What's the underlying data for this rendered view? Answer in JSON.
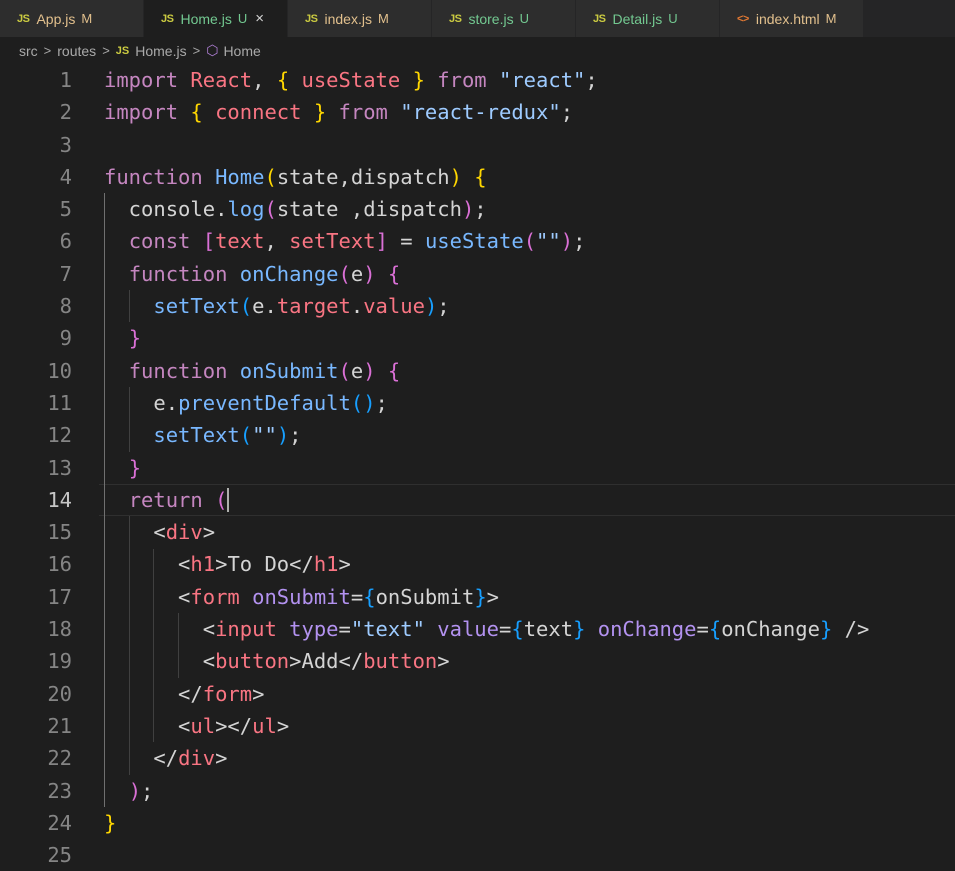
{
  "tabs": [
    {
      "icon": "JS",
      "name": "App.js",
      "status": "M",
      "name_color": "#e2c08d",
      "status_color": "#e2c08d",
      "icon_color": "#cbcb41",
      "active": false
    },
    {
      "icon": "JS",
      "name": "Home.js",
      "status": "U",
      "name_color": "#73c991",
      "status_color": "#73c991",
      "icon_color": "#cbcb41",
      "active": true,
      "close": "×"
    },
    {
      "icon": "JS",
      "name": "index.js",
      "status": "M",
      "name_color": "#e2c08d",
      "status_color": "#e2c08d",
      "icon_color": "#cbcb41",
      "active": false
    },
    {
      "icon": "JS",
      "name": "store.js",
      "status": "U",
      "name_color": "#73c991",
      "status_color": "#73c991",
      "icon_color": "#cbcb41",
      "active": false
    },
    {
      "icon": "JS",
      "name": "Detail.js",
      "status": "U",
      "name_color": "#73c991",
      "status_color": "#73c991",
      "icon_color": "#cbcb41",
      "active": false
    },
    {
      "icon": "<>",
      "name": "index.html",
      "status": "M",
      "name_color": "#e2c08d",
      "status_color": "#e2c08d",
      "icon_color": "#e37933",
      "active": false
    }
  ],
  "breadcrumb": {
    "folder1": "src",
    "folder2": "routes",
    "file_icon": "JS",
    "file": "Home.js",
    "symbol": "Home"
  },
  "current_line": 14,
  "colors": {
    "keyword": "#c586c0",
    "storage": "#569cd6",
    "function": "#dcdcaa",
    "variable": "#9cdcfe",
    "string": "#ce9178",
    "tag": "#569cd6",
    "attr": "#9cdcfe",
    "text": "#d4d4d4",
    "bracket1": "#ffd700",
    "bracket2": "#da70d6",
    "bracket3": "#179fff"
  },
  "lines": [
    {
      "n": "1",
      "t": [
        [
          "import ",
          "#c586c0"
        ],
        [
          "React",
          "#f97583"
        ],
        [
          ", ",
          "#d4d4d4"
        ],
        [
          "{",
          "#ffd700"
        ],
        [
          " ",
          "#d4d4d4"
        ],
        [
          "useState",
          "#f97583"
        ],
        [
          " ",
          "#d4d4d4"
        ],
        [
          "}",
          "#ffd700"
        ],
        [
          " ",
          "#d4d4d4"
        ],
        [
          "from",
          "#c586c0"
        ],
        [
          " ",
          "#d4d4d4"
        ],
        [
          "\"react\"",
          "#9ecbff"
        ],
        [
          ";",
          "#d4d4d4"
        ]
      ]
    },
    {
      "n": "2",
      "t": [
        [
          "import ",
          "#c586c0"
        ],
        [
          "{",
          "#ffd700"
        ],
        [
          " ",
          "#d4d4d4"
        ],
        [
          "connect",
          "#f97583"
        ],
        [
          " ",
          "#d4d4d4"
        ],
        [
          "}",
          "#ffd700"
        ],
        [
          " ",
          "#d4d4d4"
        ],
        [
          "from",
          "#c586c0"
        ],
        [
          " ",
          "#d4d4d4"
        ],
        [
          "\"react-redux\"",
          "#9ecbff"
        ],
        [
          ";",
          "#d4d4d4"
        ]
      ]
    },
    {
      "n": "3",
      "t": []
    },
    {
      "n": "4",
      "t": [
        [
          "function ",
          "#c586c0"
        ],
        [
          "Home",
          "#79b8ff"
        ],
        [
          "(",
          "#ffd700"
        ],
        [
          "state,dispatch",
          "#d4d4d4"
        ],
        [
          ")",
          "#ffd700"
        ],
        [
          " ",
          "#d4d4d4"
        ],
        [
          "{",
          "#ffd700"
        ]
      ]
    },
    {
      "n": "5",
      "t": [
        [
          "  console",
          "#d4d4d4"
        ],
        [
          ".",
          "#d4d4d4"
        ],
        [
          "log",
          "#79b8ff"
        ],
        [
          "(",
          "#da70d6"
        ],
        [
          "state ,dispatch",
          "#d4d4d4"
        ],
        [
          ")",
          "#da70d6"
        ],
        [
          ";",
          "#d4d4d4"
        ]
      ]
    },
    {
      "n": "6",
      "t": [
        [
          "  ",
          "#d4d4d4"
        ],
        [
          "const ",
          "#c586c0"
        ],
        [
          "[",
          "#da70d6"
        ],
        [
          "text",
          "#f97583"
        ],
        [
          ", ",
          "#d4d4d4"
        ],
        [
          "setText",
          "#f97583"
        ],
        [
          "]",
          "#da70d6"
        ],
        [
          " = ",
          "#d4d4d4"
        ],
        [
          "useState",
          "#79b8ff"
        ],
        [
          "(",
          "#da70d6"
        ],
        [
          "\"\"",
          "#9ecbff"
        ],
        [
          ")",
          "#da70d6"
        ],
        [
          ";",
          "#d4d4d4"
        ]
      ]
    },
    {
      "n": "7",
      "t": [
        [
          "  ",
          "#d4d4d4"
        ],
        [
          "function ",
          "#c586c0"
        ],
        [
          "onChange",
          "#79b8ff"
        ],
        [
          "(",
          "#da70d6"
        ],
        [
          "e",
          "#d4d4d4"
        ],
        [
          ")",
          "#da70d6"
        ],
        [
          " ",
          "#d4d4d4"
        ],
        [
          "{",
          "#da70d6"
        ]
      ]
    },
    {
      "n": "8",
      "t": [
        [
          "    ",
          "#d4d4d4"
        ],
        [
          "setText",
          "#79b8ff"
        ],
        [
          "(",
          "#179fff"
        ],
        [
          "e",
          "#d4d4d4"
        ],
        [
          ".",
          "#d4d4d4"
        ],
        [
          "target",
          "#f97583"
        ],
        [
          ".",
          "#d4d4d4"
        ],
        [
          "value",
          "#f97583"
        ],
        [
          ")",
          "#179fff"
        ],
        [
          ";",
          "#d4d4d4"
        ]
      ]
    },
    {
      "n": "9",
      "t": [
        [
          "  ",
          "#d4d4d4"
        ],
        [
          "}",
          "#da70d6"
        ]
      ]
    },
    {
      "n": "10",
      "t": [
        [
          "  ",
          "#d4d4d4"
        ],
        [
          "function ",
          "#c586c0"
        ],
        [
          "onSubmit",
          "#79b8ff"
        ],
        [
          "(",
          "#da70d6"
        ],
        [
          "e",
          "#d4d4d4"
        ],
        [
          ")",
          "#da70d6"
        ],
        [
          " ",
          "#d4d4d4"
        ],
        [
          "{",
          "#da70d6"
        ]
      ]
    },
    {
      "n": "11",
      "t": [
        [
          "    e",
          "#d4d4d4"
        ],
        [
          ".",
          "#d4d4d4"
        ],
        [
          "preventDefault",
          "#79b8ff"
        ],
        [
          "()",
          "#179fff"
        ],
        [
          ";",
          "#d4d4d4"
        ]
      ]
    },
    {
      "n": "12",
      "t": [
        [
          "    ",
          "#d4d4d4"
        ],
        [
          "setText",
          "#79b8ff"
        ],
        [
          "(",
          "#179fff"
        ],
        [
          "\"\"",
          "#9ecbff"
        ],
        [
          ")",
          "#179fff"
        ],
        [
          ";",
          "#d4d4d4"
        ]
      ]
    },
    {
      "n": "13",
      "t": [
        [
          "  ",
          "#d4d4d4"
        ],
        [
          "}",
          "#da70d6"
        ]
      ]
    },
    {
      "n": "14",
      "t": [
        [
          "  ",
          "#d4d4d4"
        ],
        [
          "return ",
          "#c586c0"
        ],
        [
          "(",
          "#da70d6"
        ]
      ]
    },
    {
      "n": "15",
      "t": [
        [
          "    <",
          "#d4d4d4"
        ],
        [
          "div",
          "#f97583"
        ],
        [
          ">",
          "#d4d4d4"
        ]
      ]
    },
    {
      "n": "16",
      "t": [
        [
          "      <",
          "#d4d4d4"
        ],
        [
          "h1",
          "#f97583"
        ],
        [
          ">",
          "#d4d4d4"
        ],
        [
          "To Do",
          "#d4d4d4"
        ],
        [
          "</",
          "#d4d4d4"
        ],
        [
          "h1",
          "#f97583"
        ],
        [
          ">",
          "#d4d4d4"
        ]
      ]
    },
    {
      "n": "17",
      "t": [
        [
          "      <",
          "#d4d4d4"
        ],
        [
          "form ",
          "#f97583"
        ],
        [
          "onSubmit",
          "#b392f0"
        ],
        [
          "=",
          "#d4d4d4"
        ],
        [
          "{",
          "#179fff"
        ],
        [
          "onSubmit",
          "#d4d4d4"
        ],
        [
          "}",
          "#179fff"
        ],
        [
          ">",
          "#d4d4d4"
        ]
      ]
    },
    {
      "n": "18",
      "t": [
        [
          "        <",
          "#d4d4d4"
        ],
        [
          "input ",
          "#f97583"
        ],
        [
          "type",
          "#b392f0"
        ],
        [
          "=",
          "#d4d4d4"
        ],
        [
          "\"text\"",
          "#9ecbff"
        ],
        [
          " ",
          "#d4d4d4"
        ],
        [
          "value",
          "#b392f0"
        ],
        [
          "=",
          "#d4d4d4"
        ],
        [
          "{",
          "#179fff"
        ],
        [
          "text",
          "#d4d4d4"
        ],
        [
          "}",
          "#179fff"
        ],
        [
          " ",
          "#d4d4d4"
        ],
        [
          "onChange",
          "#b392f0"
        ],
        [
          "=",
          "#d4d4d4"
        ],
        [
          "{",
          "#179fff"
        ],
        [
          "onChange",
          "#d4d4d4"
        ],
        [
          "}",
          "#179fff"
        ],
        [
          " />",
          "#d4d4d4"
        ]
      ]
    },
    {
      "n": "19",
      "t": [
        [
          "        <",
          "#d4d4d4"
        ],
        [
          "button",
          "#f97583"
        ],
        [
          ">",
          "#d4d4d4"
        ],
        [
          "Add",
          "#d4d4d4"
        ],
        [
          "</",
          "#d4d4d4"
        ],
        [
          "button",
          "#f97583"
        ],
        [
          ">",
          "#d4d4d4"
        ]
      ]
    },
    {
      "n": "20",
      "t": [
        [
          "      </",
          "#d4d4d4"
        ],
        [
          "form",
          "#f97583"
        ],
        [
          ">",
          "#d4d4d4"
        ]
      ]
    },
    {
      "n": "21",
      "t": [
        [
          "      <",
          "#d4d4d4"
        ],
        [
          "ul",
          "#f97583"
        ],
        [
          "></",
          "#d4d4d4"
        ],
        [
          "ul",
          "#f97583"
        ],
        [
          ">",
          "#d4d4d4"
        ]
      ]
    },
    {
      "n": "22",
      "t": [
        [
          "    </",
          "#d4d4d4"
        ],
        [
          "div",
          "#f97583"
        ],
        [
          ">",
          "#d4d4d4"
        ]
      ]
    },
    {
      "n": "23",
      "t": [
        [
          "  ",
          "#d4d4d4"
        ],
        [
          ")",
          "#da70d6"
        ],
        [
          ";",
          "#d4d4d4"
        ]
      ]
    },
    {
      "n": "24",
      "t": [
        [
          "}",
          "#ffd700"
        ]
      ]
    },
    {
      "n": "25",
      "t": []
    }
  ]
}
